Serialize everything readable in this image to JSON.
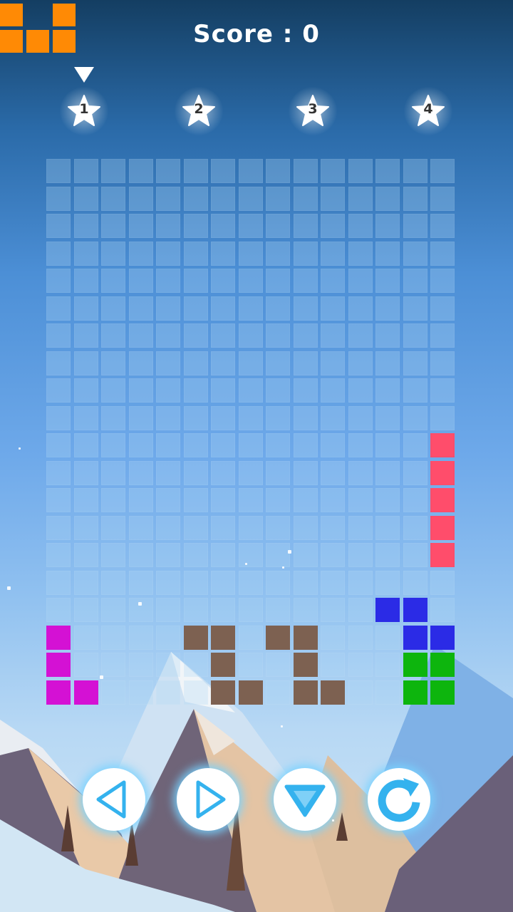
{
  "score": {
    "label": "Score : ",
    "value": "0"
  },
  "levels": [
    {
      "number": "1",
      "selected": true
    },
    {
      "number": "2",
      "selected": false
    },
    {
      "number": "3",
      "selected": false
    },
    {
      "number": "4",
      "selected": false
    }
  ],
  "next_piece": {
    "color": "#ff8a05",
    "cells": [
      [
        0,
        0
      ],
      [
        2,
        0
      ],
      [
        0,
        1
      ],
      [
        1,
        1
      ],
      [
        2,
        1
      ]
    ]
  },
  "board": {
    "columns": 15,
    "rows": 20,
    "pieces": [
      {
        "name": "magenta-l-piece",
        "color": "#d411d4",
        "cells": [
          [
            0,
            17
          ],
          [
            0,
            18
          ],
          [
            0,
            19
          ],
          [
            1,
            19
          ]
        ]
      },
      {
        "name": "brown-z-piece-left",
        "color": "#7d6151",
        "cells": [
          [
            5,
            17
          ],
          [
            6,
            17
          ],
          [
            6,
            18
          ],
          [
            6,
            19
          ],
          [
            7,
            19
          ]
        ]
      },
      {
        "name": "brown-z-piece-right",
        "color": "#7d6151",
        "cells": [
          [
            8,
            17
          ],
          [
            9,
            17
          ],
          [
            9,
            18
          ],
          [
            9,
            19
          ],
          [
            10,
            19
          ]
        ]
      },
      {
        "name": "red-i-piece",
        "color": "#ff4d6b",
        "cells": [
          [
            14,
            10
          ],
          [
            14,
            11
          ],
          [
            14,
            12
          ],
          [
            14,
            13
          ],
          [
            14,
            14
          ]
        ]
      },
      {
        "name": "blue-z-piece",
        "color": "#2b2be6",
        "cells": [
          [
            12,
            16
          ],
          [
            13,
            16
          ],
          [
            13,
            17
          ],
          [
            14,
            17
          ]
        ]
      },
      {
        "name": "green-o-piece",
        "color": "#0db50d",
        "cells": [
          [
            13,
            18
          ],
          [
            14,
            18
          ],
          [
            13,
            19
          ],
          [
            14,
            19
          ]
        ]
      }
    ]
  },
  "controls": [
    {
      "name": "move-left-button",
      "icon": "triangle-left-icon"
    },
    {
      "name": "move-right-button",
      "icon": "triangle-right-icon"
    },
    {
      "name": "drop-down-button",
      "icon": "triangle-down-icon"
    },
    {
      "name": "rotate-button",
      "icon": "rotate-icon"
    }
  ],
  "colors": {
    "control_accent": "#34b2ee",
    "sky_top": "#143e62",
    "sky_bottom": "#cfe6f7"
  }
}
